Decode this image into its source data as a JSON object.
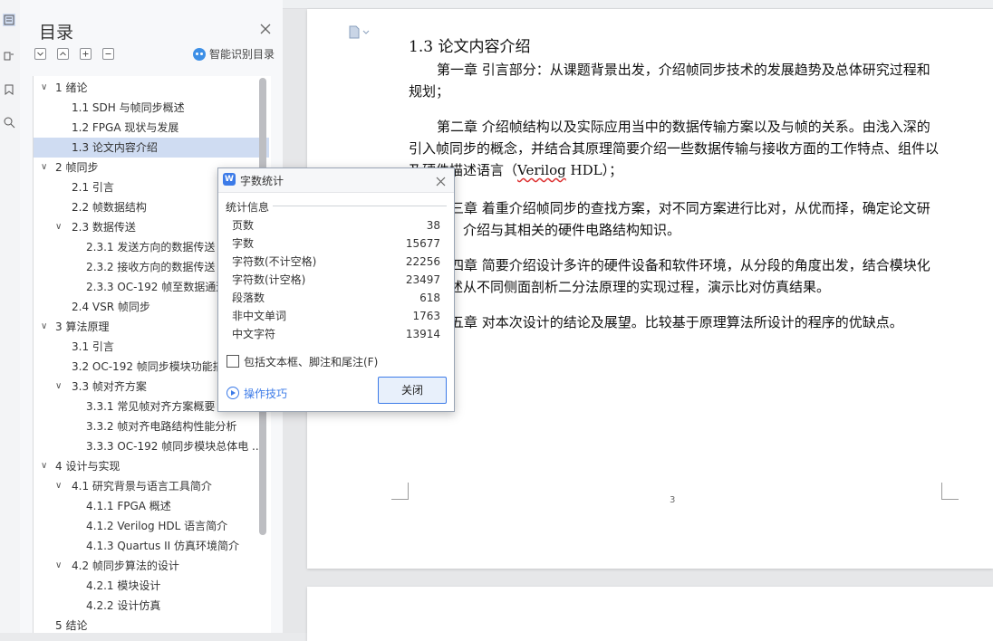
{
  "toc_panel": {
    "title": "目录",
    "smart_label": "智能识别目录",
    "items": [
      {
        "caret": "∨",
        "text": "1  绪论",
        "level": 0,
        "selected": false
      },
      {
        "caret": "",
        "text": "1.1 SDH 与帧同步概述",
        "level": 1,
        "selected": false
      },
      {
        "caret": "",
        "text": "1.2 FPGA 现状与发展",
        "level": 1,
        "selected": false
      },
      {
        "caret": "",
        "text": "1.3  论文内容介绍",
        "level": 1,
        "selected": true
      },
      {
        "caret": "∨",
        "text": "2  帧同步",
        "level": 0,
        "selected": false
      },
      {
        "caret": "",
        "text": "2.1  引言",
        "level": 1,
        "selected": false
      },
      {
        "caret": "",
        "text": "2.2  帧数据结构",
        "level": 1,
        "selected": false
      },
      {
        "caret": "∨",
        "text": "2.3 数据传送",
        "level": 1,
        "selected": false
      },
      {
        "caret": "",
        "text": "2.3.1  发送方向的数据传送",
        "level": 2,
        "selected": false
      },
      {
        "caret": "",
        "text": "2.3.2  接收方向的数据传送",
        "level": 2,
        "selected": false
      },
      {
        "caret": "",
        "text": "2.3.3 OC-192  帧至数据通道",
        "level": 2,
        "selected": false
      },
      {
        "caret": "",
        "text": "2.4 VSR 帧同步",
        "level": 1,
        "selected": false
      },
      {
        "caret": "∨",
        "text": "3  算法原理",
        "level": 0,
        "selected": false
      },
      {
        "caret": "",
        "text": "3.1  引言",
        "level": 1,
        "selected": false
      },
      {
        "caret": "",
        "text": "3.2 OC-192  帧同步模块功能描述",
        "level": 1,
        "selected": false
      },
      {
        "caret": "∨",
        "text": "3.3  帧对齐方案",
        "level": 1,
        "selected": false
      },
      {
        "caret": "",
        "text": "3.3.1  常见帧对齐方案概要",
        "level": 2,
        "selected": false
      },
      {
        "caret": "",
        "text": "3.3.2  帧对齐电路结构性能分析",
        "level": 2,
        "selected": false
      },
      {
        "caret": "",
        "text": "3.3.3 OC-192  帧同步模块总体电 ...",
        "level": 2,
        "selected": false
      },
      {
        "caret": "∨",
        "text": "4  设计与实现",
        "level": 0,
        "selected": false
      },
      {
        "caret": "∨",
        "text": "4.1 研究背景与语言工具简介",
        "level": 1,
        "selected": false
      },
      {
        "caret": "",
        "text": "4.1.1 FPGA 概述",
        "level": 2,
        "selected": false
      },
      {
        "caret": "",
        "text": "4.1.2 Verilog HDL 语言简介",
        "level": 2,
        "selected": false
      },
      {
        "caret": "",
        "text": "4.1.3 Quartus II 仿真环境简介",
        "level": 2,
        "selected": false
      },
      {
        "caret": "∨",
        "text": "4.2  帧同步算法的设计",
        "level": 1,
        "selected": false
      },
      {
        "caret": "",
        "text": "4.2.1  模块设计",
        "level": 2,
        "selected": false
      },
      {
        "caret": "",
        "text": "4.2.2  设计仿真",
        "level": 2,
        "selected": false
      },
      {
        "caret": "",
        "text": "5  结论",
        "level": 0,
        "selected": false
      }
    ]
  },
  "document": {
    "heading": "1.3  论文内容介绍",
    "paragraphs": [
      "第一章  引言部分：从课题背景出发，介绍帧同步技术的发展趋势及总体研究过程和规划；",
      "第二章  介绍帧结构以及实际应用当中的数据传输方案以及与帧的关系。由浅入深的引入帧同步的概念，并结合其原理简要介绍一些数据传输与接收方面的工作特点、组件以及硬件描述语言（Verilog HDL）；",
      "第三章  着重介绍帧同步的查找方案，对不同方案进行比对，从优而择，确定论文研究方向。介绍与其相关的硬件电路结构知识。",
      "第四章  简要介绍设计多许的硬件设备和软件环境，从分段的角度出发，结合模块化语言描述从不同侧面剖析二分法原理的实现过程，演示比对仿真结果。",
      "第五章  对本次设计的结论及展望。比较基于原理算法所设计的程序的优缺点。"
    ],
    "page_number": "3"
  },
  "dialog": {
    "title": "字数统计",
    "group_label": "统计信息",
    "stats": [
      {
        "label": "页数",
        "value": "38"
      },
      {
        "label": "字数",
        "value": "15677"
      },
      {
        "label": "字符数(不计空格)",
        "value": "22256"
      },
      {
        "label": "字符数(计空格)",
        "value": "23497"
      },
      {
        "label": "段落数",
        "value": "618"
      },
      {
        "label": "非中文单词",
        "value": "1763"
      },
      {
        "label": "中文字符",
        "value": "13914"
      }
    ],
    "checkbox_label": "包括文本框、脚注和尾注(F)",
    "tips_label": "操作技巧",
    "close_label": "关闭"
  }
}
